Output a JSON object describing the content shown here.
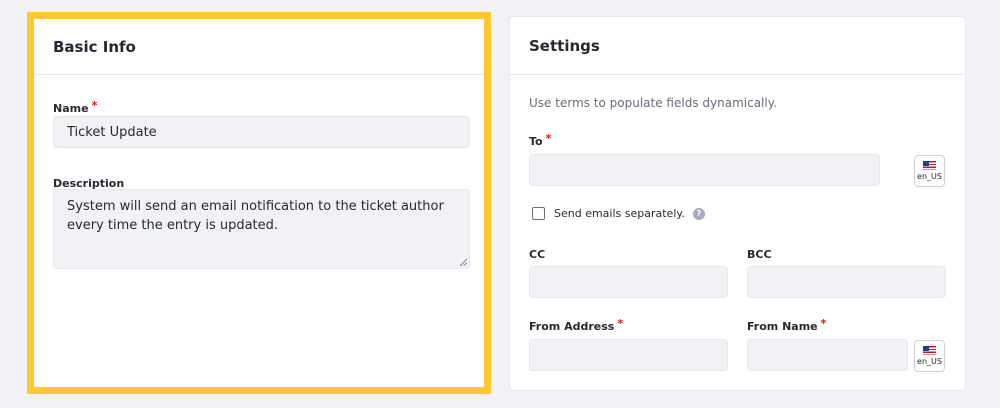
{
  "basic_info": {
    "title": "Basic Info",
    "name_label": "Name",
    "name_required": "*",
    "name_value": "Ticket Update",
    "description_label": "Description",
    "description_value": "System will send an email notification to the ticket author every time the entry is updated."
  },
  "settings": {
    "title": "Settings",
    "hint": "Use terms to populate fields dynamically.",
    "to_label": "To",
    "to_required": "*",
    "to_value": "",
    "to_locale": "en_US",
    "send_separately_label": "Send emails separately.",
    "send_separately_checked": false,
    "help_symbol": "?",
    "cc_label": "CC",
    "cc_value": "",
    "bcc_label": "BCC",
    "bcc_value": "",
    "from_address_label": "From Address",
    "from_address_required": "*",
    "from_address_value": "",
    "from_name_label": "From Name",
    "from_name_required": "*",
    "from_name_value": "",
    "from_name_locale": "en_US"
  },
  "colors": {
    "highlight": "#ffc833",
    "required": "#da1414",
    "input_bg": "#f1f2f5"
  }
}
